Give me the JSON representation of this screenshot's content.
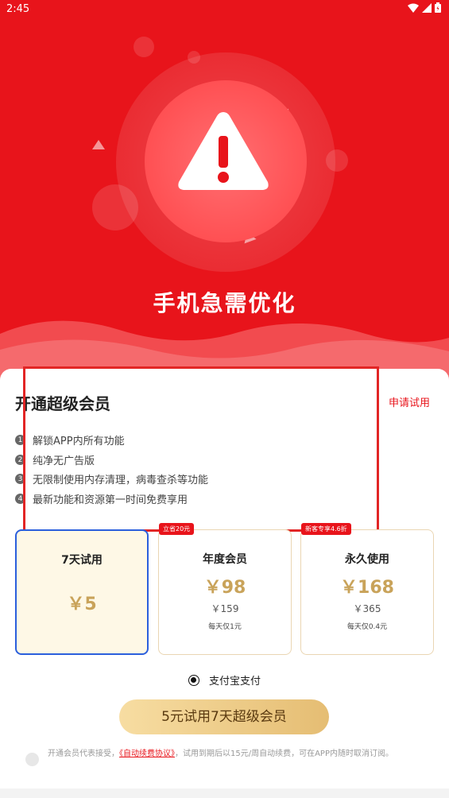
{
  "status_bar": {
    "time": "2:45"
  },
  "hero": {
    "title": "手机急需优化"
  },
  "card": {
    "title": "开通超级会员",
    "trial_link": "申请试用",
    "features": [
      {
        "num": "1",
        "text": "解锁APP内所有功能"
      },
      {
        "num": "2",
        "text": "纯净无广告版"
      },
      {
        "num": "3",
        "text": "无限制使用内存清理，病毒查杀等功能"
      },
      {
        "num": "4",
        "text": "最新功能和资源第一时间免费享用"
      }
    ]
  },
  "plans": [
    {
      "name": "7天试用",
      "price": "￥5",
      "selected": true
    },
    {
      "name": "年度会员",
      "price": "￥98",
      "original": "￥159",
      "daily": "每天仅1元",
      "badge": "立省20元"
    },
    {
      "name": "永久使用",
      "price": "￥168",
      "original": "￥365",
      "daily": "每天仅0.4元",
      "badge": "新客专享4.6折"
    }
  ],
  "payment": {
    "method": "支付宝支付"
  },
  "cta": {
    "label": "5元试用7天超级会员"
  },
  "agreement": {
    "prefix": "开通会员代表接受，",
    "link": "《自动续费协议》",
    "suffix": "，试用到期后以15元/周自动续费，可在APP内随时取消订阅。"
  },
  "colors": {
    "brand_red": "#e8141b",
    "gold": "#c9a35a",
    "selected_border": "#2b5fdc"
  }
}
